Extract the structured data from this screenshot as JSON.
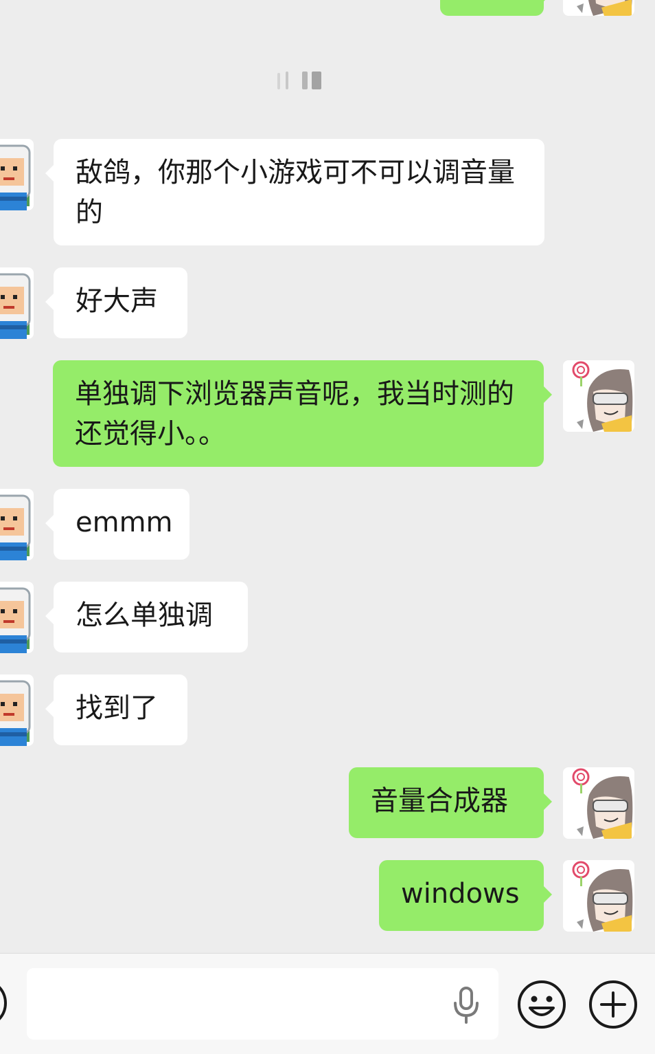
{
  "messages": [
    {
      "from": "me",
      "text": ""
    },
    {
      "from": "other",
      "text": "敌鸽，你那个小游戏可不可以调音量的"
    },
    {
      "from": "other",
      "text": "好大声"
    },
    {
      "from": "me",
      "text": "单独调下浏览器声音呢，我当时测的还觉得小。。"
    },
    {
      "from": "other",
      "text": "emmm"
    },
    {
      "from": "other",
      "text": "怎么单独调"
    },
    {
      "from": "other",
      "text": "找到了"
    },
    {
      "from": "me",
      "text": "音量合成器"
    },
    {
      "from": "me",
      "text": "windows"
    }
  ],
  "input": {
    "value": "",
    "placeholder": ""
  },
  "icons": {
    "voice": "voice-toggle-icon",
    "mic": "microphone-icon",
    "emoji": "emoji-icon",
    "more": "plus-icon"
  },
  "colors": {
    "background": "#ededed",
    "incoming_bubble": "#ffffff",
    "outgoing_bubble": "#95ec69",
    "text": "#191919"
  }
}
